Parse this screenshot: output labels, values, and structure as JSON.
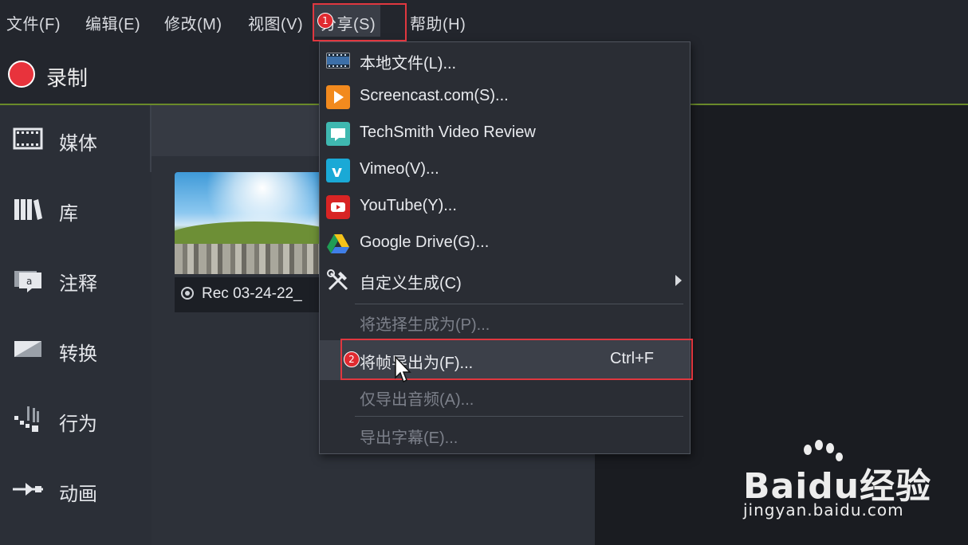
{
  "menubar": {
    "items": [
      "文件(F)",
      "编辑(E)",
      "修改(M)",
      "视图(V)",
      "分享(S)",
      "帮助(H)"
    ]
  },
  "record": {
    "label": "录制"
  },
  "sidebar": {
    "items": [
      {
        "label": "媒体",
        "icon": "film-icon"
      },
      {
        "label": "库",
        "icon": "library-icon"
      },
      {
        "label": "注释",
        "icon": "annotation-icon"
      },
      {
        "label": "转换",
        "icon": "transition-icon"
      },
      {
        "label": "行为",
        "icon": "behavior-icon"
      },
      {
        "label": "动画",
        "icon": "animation-icon"
      }
    ]
  },
  "media": {
    "clip_name": "Rec 03-24-22_"
  },
  "share_menu": {
    "items": [
      {
        "label": "本地文件(L)...",
        "icon": "film-icon",
        "enabled": true
      },
      {
        "label": "Screencast.com(S)...",
        "icon": "screencast-icon",
        "enabled": true
      },
      {
        "label": "TechSmith Video Review",
        "icon": "video-review-icon",
        "enabled": true
      },
      {
        "label": "Vimeo(V)...",
        "icon": "vimeo-icon",
        "enabled": true
      },
      {
        "label": "YouTube(Y)...",
        "icon": "youtube-icon",
        "enabled": true
      },
      {
        "label": "Google Drive(G)...",
        "icon": "google-drive-icon",
        "enabled": true
      },
      {
        "label": "自定义生成(C)",
        "icon": "tools-icon",
        "enabled": true,
        "submenu": true
      },
      {
        "label": "将选择生成为(P)...",
        "enabled": false
      },
      {
        "label": "将帧导出为(F)...",
        "enabled": true,
        "shortcut": "Ctrl+F",
        "highlighted": true
      },
      {
        "label": "仅导出音频(A)...",
        "enabled": false
      },
      {
        "label": "导出字幕(E)...",
        "enabled": false
      }
    ]
  },
  "annotations": {
    "badge1": "1",
    "badge2": "2"
  },
  "watermark": {
    "brand": "Baidu经验",
    "url": "jingyan.baidu.com"
  },
  "colors": {
    "accent_red": "#e8333c",
    "highlight_box": "#e0373f",
    "bar_line": "#6a8a2a"
  }
}
